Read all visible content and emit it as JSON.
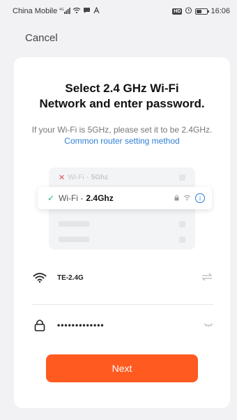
{
  "status_bar": {
    "carrier": "China Mobile",
    "signal_badge": "4G",
    "badge_hd": "HD",
    "time": "16:06",
    "battery_fraction": 0.4
  },
  "nav": {
    "cancel_label": "Cancel"
  },
  "content": {
    "title_line1": "Select 2.4 GHz Wi-Fi",
    "title_line2": "Network and enter password.",
    "subtitle_text": "If your Wi-Fi is 5GHz, please set it to be 2.4GHz. ",
    "subtitle_link": "Common router setting method"
  },
  "illustration": {
    "row_5g_prefix": "Wi-Fi - ",
    "row_5g_band": "5Ghz",
    "row_24_prefix": "Wi-Fi - ",
    "row_24_band": "2.4Ghz",
    "info_glyph": "i"
  },
  "form": {
    "ssid_value": "TE-2.4G",
    "password_value": "•••••••••••••"
  },
  "actions": {
    "next_label": "Next"
  },
  "colors": {
    "accent": "#ff5a20",
    "link": "#2f7fd6",
    "check": "#2cb37c",
    "error": "#e05151"
  },
  "icons": {
    "wifi": "wifi-icon",
    "lock": "lock-icon",
    "swap": "swap-icon",
    "eye": "eye-closed-icon"
  }
}
